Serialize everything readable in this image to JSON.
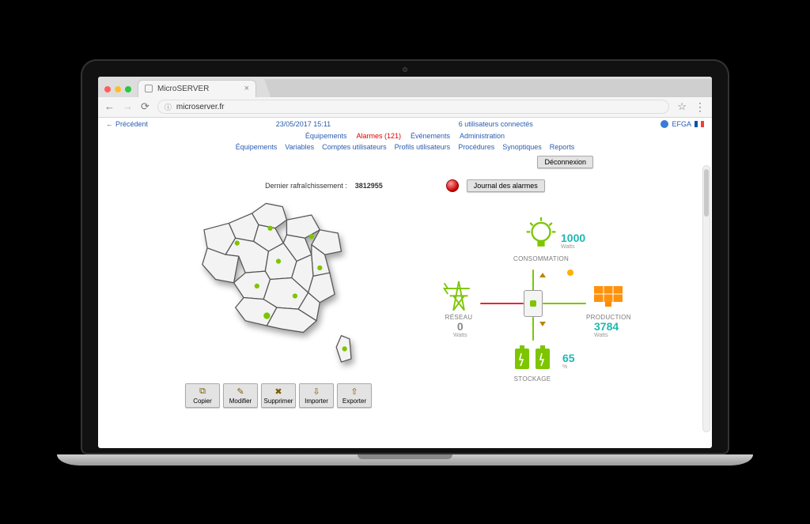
{
  "browser": {
    "tab_title": "MicroSERVER",
    "url": "microserver.fr"
  },
  "header": {
    "back": "Précédent",
    "datetime": "23/05/2017 15:11",
    "users_connected": "6 utilisateurs connectés",
    "username": "EFGA"
  },
  "nav": {
    "main": [
      "Équipements",
      "Alarmes (121)",
      "Événements",
      "Administration"
    ],
    "sub": [
      "Équipements",
      "Variables",
      "Comptes utilisateurs",
      "Profils utilisateurs",
      "Procédures",
      "Synoptiques",
      "Reports"
    ]
  },
  "buttons": {
    "logout": "Déconnexion",
    "alarm_journal": "Journal des alarmes"
  },
  "status": {
    "last_refresh_label": "Dernier rafraîchissement :",
    "last_refresh_value": "3812955"
  },
  "toolbar": [
    "Copier",
    "Modifier",
    "Supprimer",
    "Importer",
    "Exporter"
  ],
  "diagram": {
    "consumption": {
      "title": "CONSOMMATION",
      "value": "1000",
      "unit": "Watts"
    },
    "network": {
      "title": "RÉSEAU",
      "value": "0",
      "unit": "Watts"
    },
    "production": {
      "title": "PRODUCTION",
      "value": "3784",
      "unit": "Watts"
    },
    "storage": {
      "title": "STOCKAGE",
      "value": "65",
      "unit": "%"
    }
  }
}
